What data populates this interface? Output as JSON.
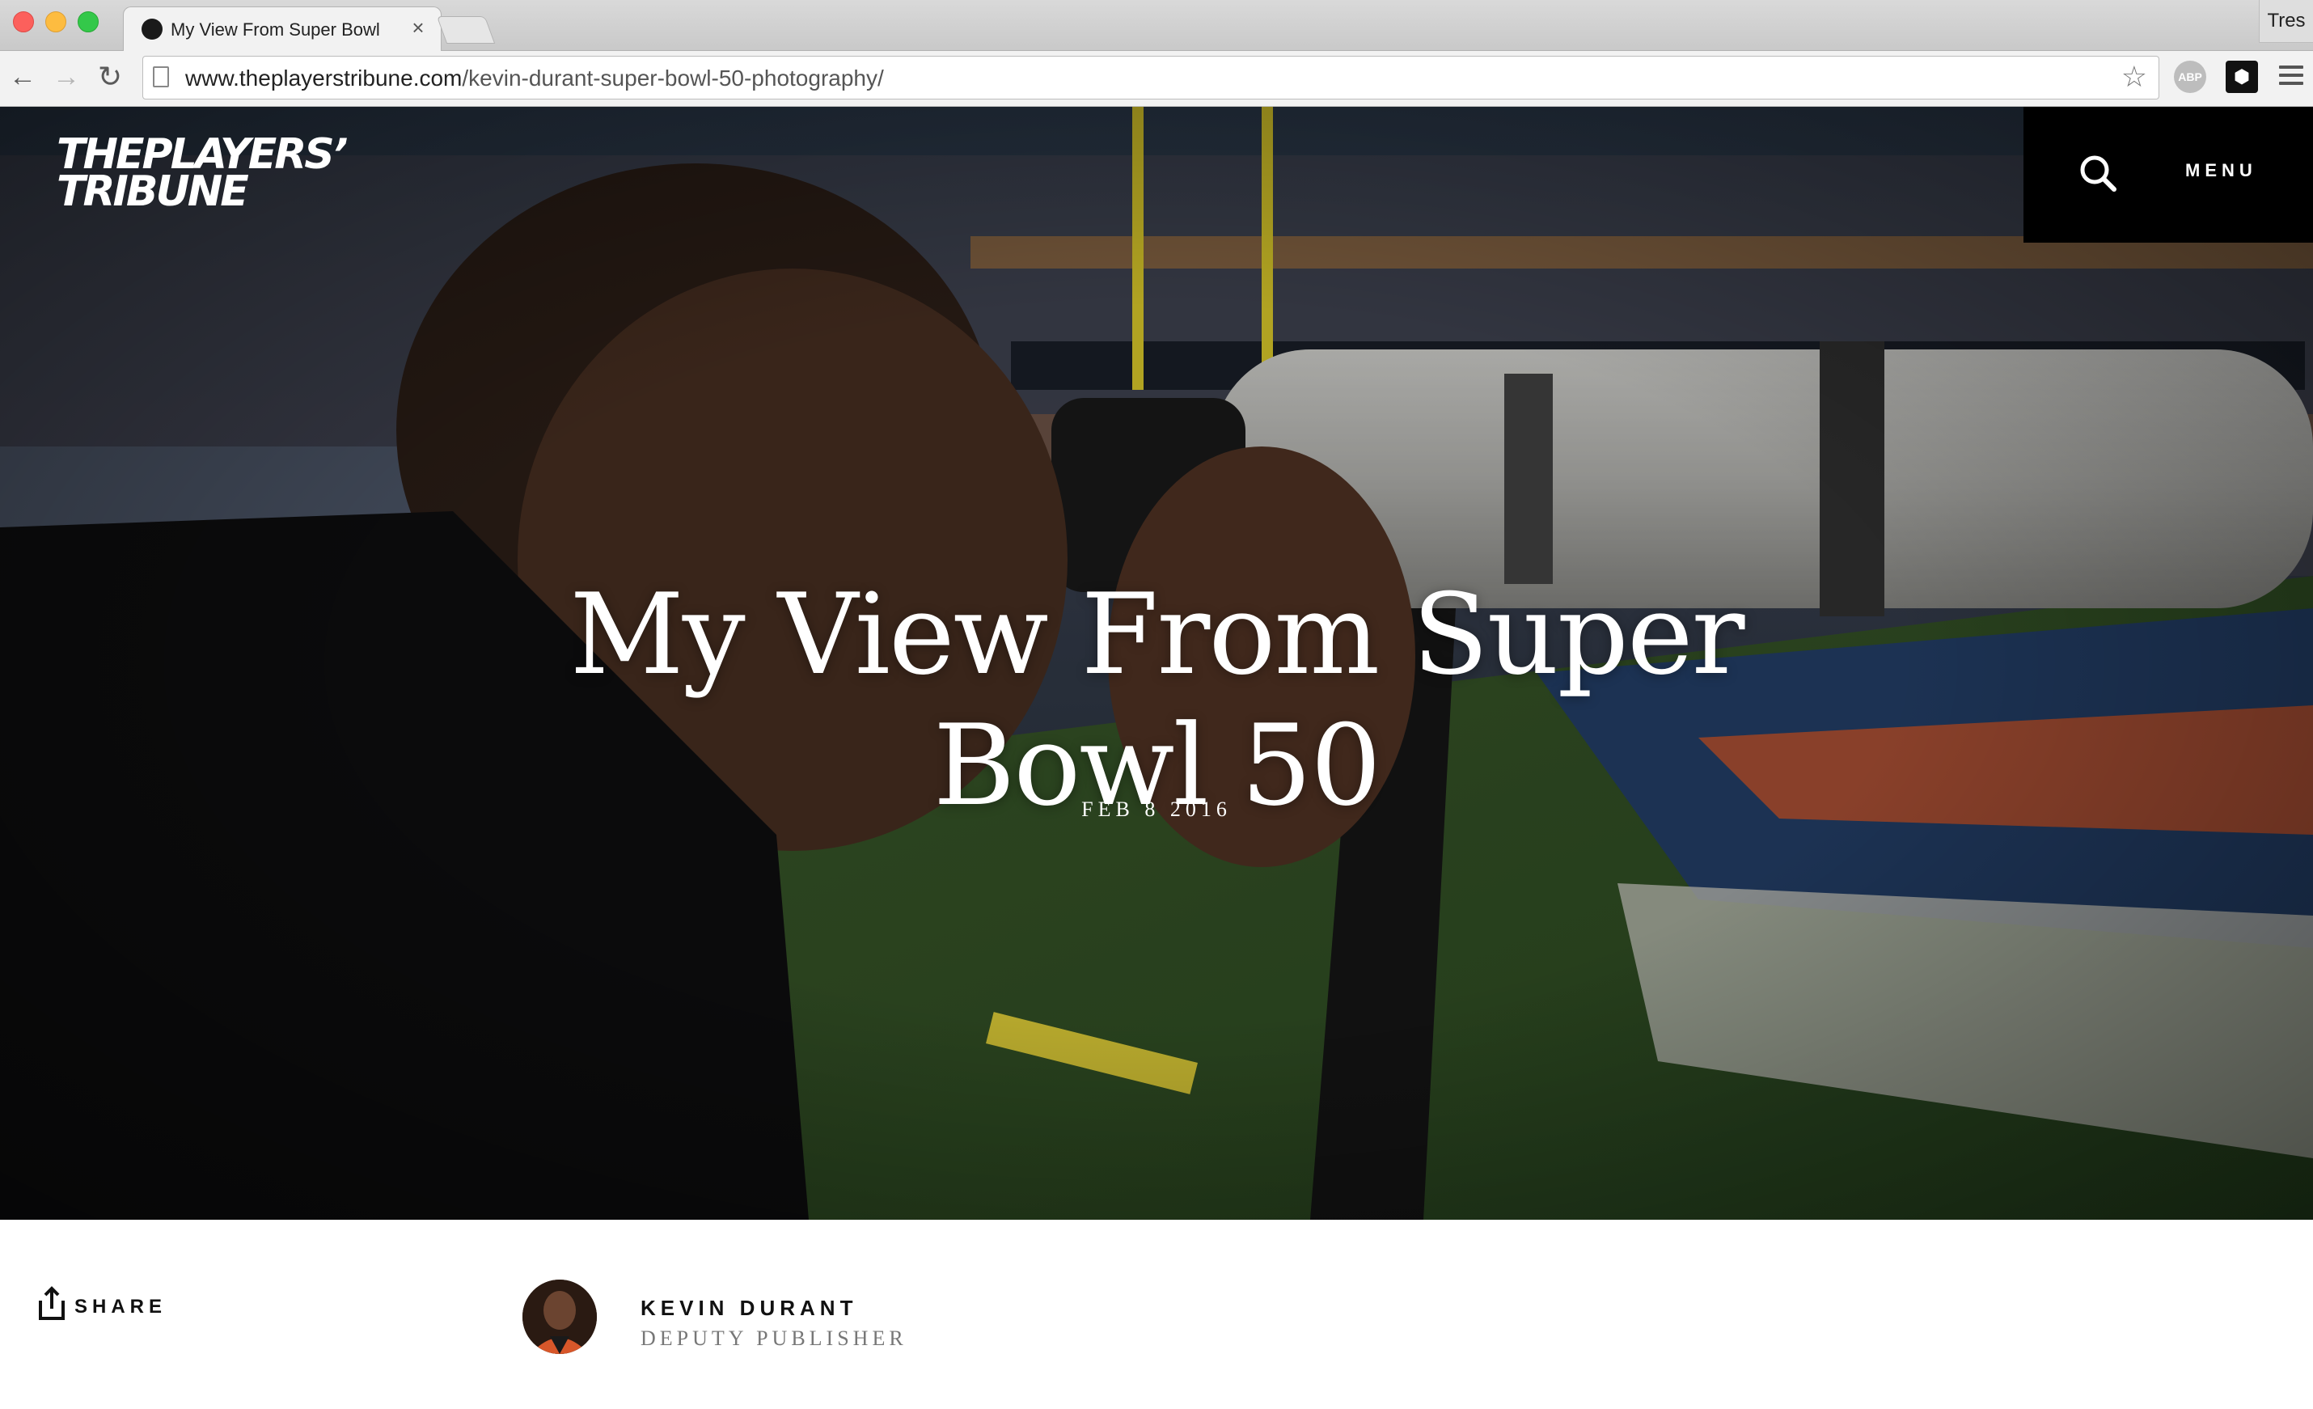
{
  "browser": {
    "tab_title": "My View From Super Bowl",
    "tab_close": "×",
    "profile_name": "Tres",
    "url_host": "www.theplayerstribune.com",
    "url_path": "/kevin-durant-super-bowl-50-photography/",
    "extensions": [
      "ABP",
      "⬢"
    ]
  },
  "site": {
    "logo_line1": "THEPLAYERS’",
    "logo_line2": "TRIBUNE",
    "menu_label": "MENU"
  },
  "article": {
    "title": "My View From Super Bowl 50",
    "date": "FEB 8 2016",
    "share_label": "SHARE",
    "author_name": "KEVIN DURANT",
    "author_role": "DEPUTY PUBLISHER"
  },
  "colors": {
    "hero_overlay": "#000000",
    "nav_background": "#000000",
    "text_on_hero": "#ffffff"
  }
}
